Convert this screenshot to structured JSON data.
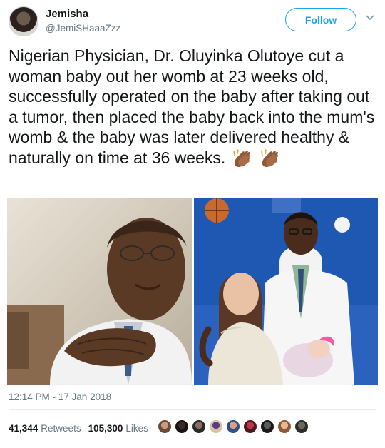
{
  "author": {
    "name": "Jemisha",
    "handle": "@JemiSHaaaZzz"
  },
  "follow_label": "Follow",
  "tweet": {
    "text": "Nigerian Physician, Dr. Oluyinka Olutoye cut a woman baby out her womb at 23 weeks old, successfully operated on the baby after taking out a tumor, then placed the baby back into the mum's womb & the baby was later delivered healthy & naturally on time at 36 weeks.",
    "emoji": [
      "clapping-hands",
      "clapping-hands"
    ]
  },
  "timestamp": "12:14 PM - 17 Jan 2018",
  "stats": {
    "retweets_count": "41,344",
    "retweets_label": "Retweets",
    "likes_count": "105,300",
    "likes_label": "Likes"
  },
  "likers_count": 9,
  "colors": {
    "accent": "#1da1f2",
    "text": "#14171a",
    "muted": "#657786",
    "divider": "#e6ecf0"
  }
}
